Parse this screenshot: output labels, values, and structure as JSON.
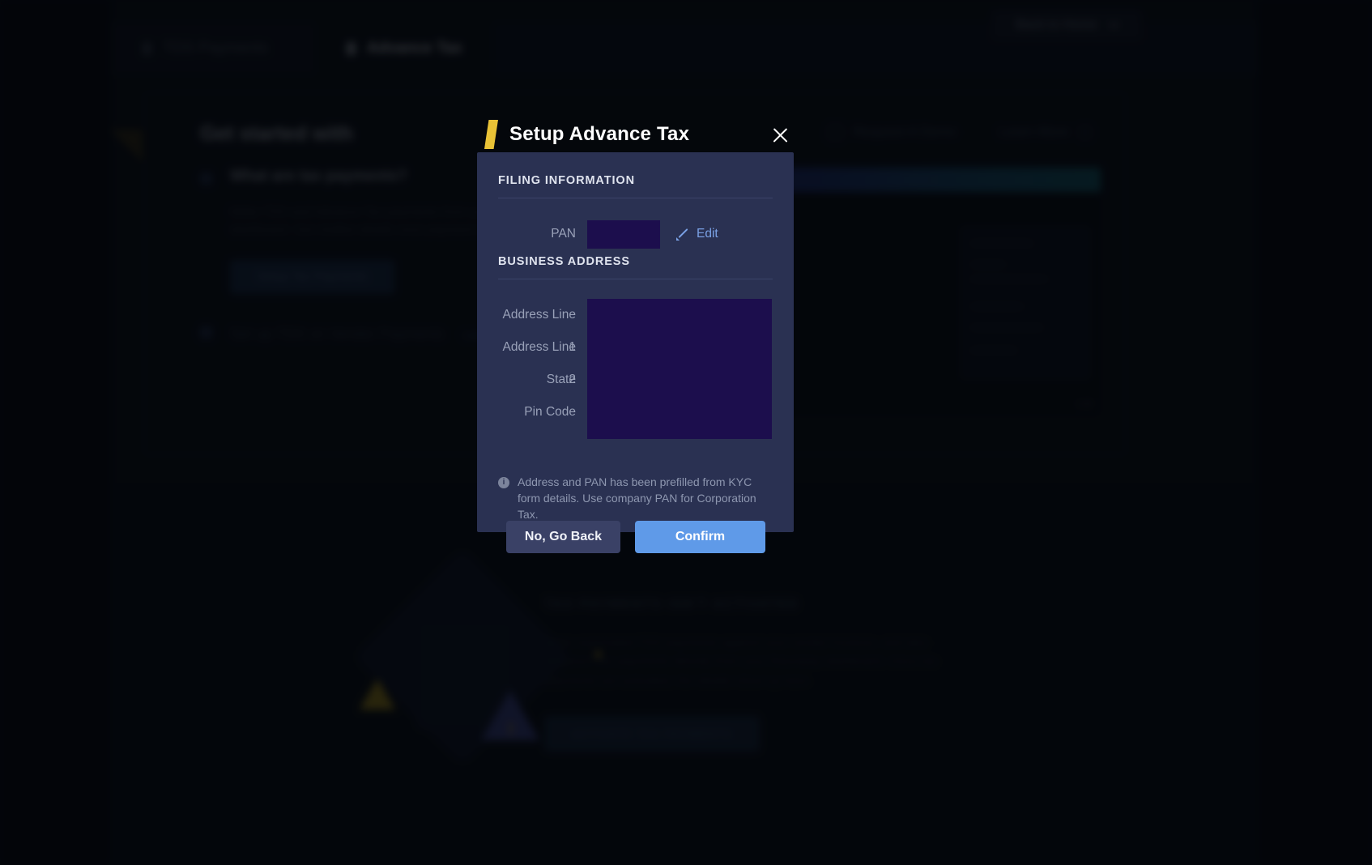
{
  "app": {
    "tabs": [
      {
        "label": "TDS Payments",
        "icon": "bank-icon",
        "active": false
      },
      {
        "label": "Advance Tax",
        "icon": "bank-icon",
        "active": true
      }
    ],
    "back_home_label": "Back to Home",
    "chevron_icon": "chevron-down-icon"
  },
  "card": {
    "heading": "Get started with",
    "links": [
      {
        "label": "Request A Demo",
        "icon": "calendar-icon"
      },
      {
        "label": "Learn More",
        "icon": "external-link-icon"
      }
    ],
    "accordion": {
      "item1_title": "What are tax payments?",
      "item1_body": "Make TDS and Advance Tax payments from your Razorpay dashboard. Get challan details once payment is done.",
      "item1_button": "Setup Tax Payments",
      "item2_title": "Set up TDS on Vendor Payments",
      "item2_link": "Learn More"
    },
    "video": {
      "panel_title": "Vendor Payments",
      "play_icon": "play-icon",
      "tag": "1:08"
    }
  },
  "empty_state": {
    "title": "TAX PAYMENTS ISN'T ACTIVATED",
    "body": "Make automated TDS payments against your vendor invoices, and also Advance Tax payments directly from your Razorpay dashboard. Once tax payments are activated, the details show up here.",
    "button": "ACTIVATE TAX PAYMENTS",
    "illustration_icon": "warning-illustration"
  },
  "modal": {
    "title": "Setup Advance Tax",
    "logo_icon": "razorpay-logo-mark",
    "close_icon": "close-icon",
    "sections": {
      "filing": {
        "label": "FILING INFORMATION",
        "pan_label": "PAN",
        "pan_value": "",
        "edit_label": "Edit",
        "edit_icon": "pencil-icon"
      },
      "business_address": {
        "label": "BUSINESS ADDRESS",
        "fields": [
          {
            "label": "Address Line 1",
            "value": ""
          },
          {
            "label": "Address Line 2",
            "value": ""
          },
          {
            "label": "State",
            "value": ""
          },
          {
            "label": "Pin Code",
            "value": ""
          }
        ]
      }
    },
    "note": {
      "icon": "info-icon",
      "text": "Address and PAN has been prefilled from KYC form details. Use company PAN for Corporation Tax."
    },
    "buttons": {
      "secondary": "No, Go Back",
      "primary": "Confirm"
    }
  },
  "colors": {
    "modal_bg": "#2a3152",
    "primary_button": "#5f9ae8",
    "secondary_button": "#3a4166",
    "accent_logo": "#e9c236",
    "redaction": "#1c0e4d",
    "link": "#7ba2e6"
  }
}
